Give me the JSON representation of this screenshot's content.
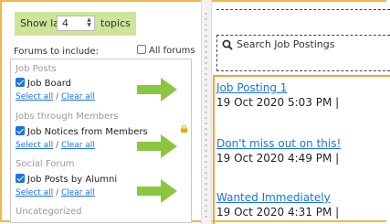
{
  "show_last": {
    "prefix": "Show last",
    "value": "4",
    "suffix": "topics"
  },
  "forums_label": "Forums to include:",
  "all_forums_label": "All forums",
  "groups": [
    {
      "category": "Job Posts",
      "forum": "Job Board",
      "select_all": "Select all",
      "separator": "/",
      "clear_all": "Clear all",
      "checked": true
    },
    {
      "category": "Jobs through Members",
      "forum": "Job Notices from Members",
      "select_all": "Select all",
      "separator": "/",
      "clear_all": "Clear all",
      "checked": true,
      "locked": true
    },
    {
      "category": "Social Forum",
      "forum": "Job Posts by Alumni",
      "select_all": "Select all",
      "separator": "/",
      "clear_all": "Clear all",
      "checked": true
    },
    {
      "category": "Uncategorized"
    }
  ],
  "search": {
    "placeholder": "Search Job Postings"
  },
  "posts": [
    {
      "title": "Job Posting 1",
      "date": "19 Oct 2020 5:03 PM |"
    },
    {
      "title": "Don't miss out on this!",
      "date": "19 Oct 2020 4:49 PM |"
    },
    {
      "title": "Wanted Immediately",
      "date": "19 Oct 2020 4:31 PM |"
    }
  ],
  "colors": {
    "arrow": "#8cc63f",
    "highlight": "#cfe39a",
    "link": "#1a73e8",
    "frame": "#f3b54a",
    "lock": "#f0a800"
  },
  "icons": {
    "search": "search-icon",
    "lock": "lock-icon",
    "arrow": "arrow-right-icon"
  }
}
